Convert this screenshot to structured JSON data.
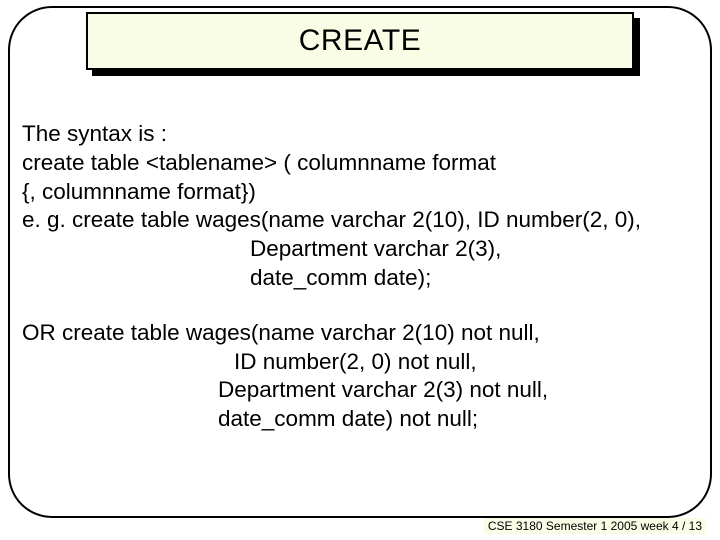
{
  "title": "CREATE",
  "body": {
    "l1": "The syntax is :",
    "l2": "create table <tablename> ( columnname format",
    "l3": "{, columnname format})",
    "l4": "e. g.  create table wages(name varchar 2(10), ID number(2, 0),",
    "l5": "Department varchar 2(3),",
    "l6": "date_comm  date);",
    "l7": "OR    create table wages(name varchar 2(10) not null,",
    "l8": " ID number(2, 0) not null,",
    "l9": "Department varchar 2(3) not null,",
    "l10": "date_comm date) not null;"
  },
  "footer": "CSE 3180 Semester 1 2005  week 4 / 13"
}
